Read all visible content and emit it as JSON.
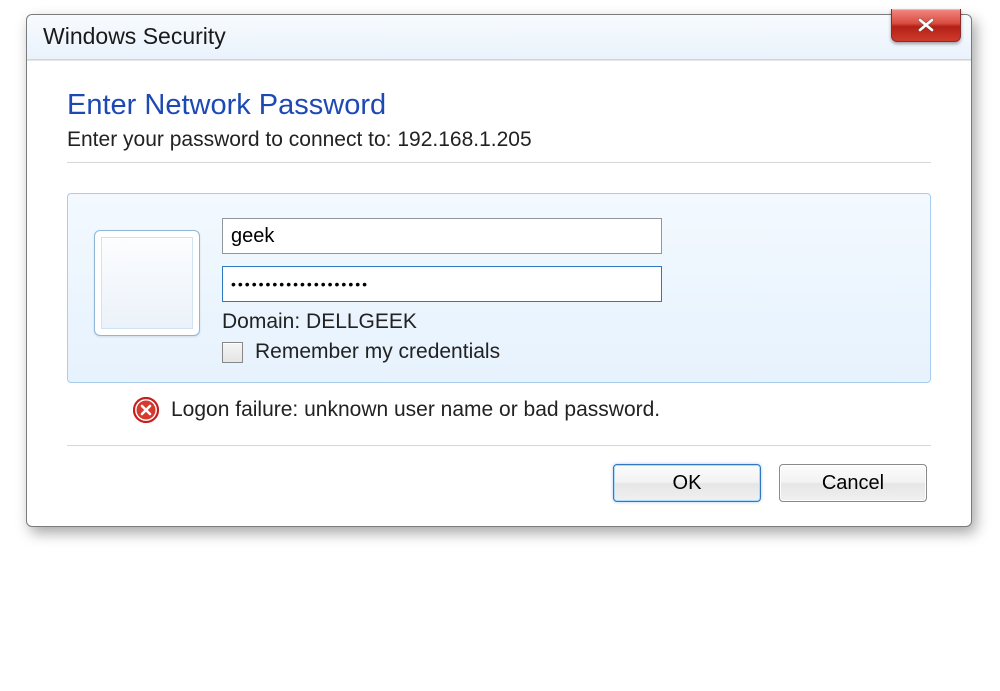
{
  "window": {
    "title": "Windows Security",
    "close_icon": "close-icon"
  },
  "dialog": {
    "heading": "Enter Network Password",
    "subheading": "Enter your password to connect to: 192.168.1.205"
  },
  "credentials": {
    "username_value": "geek",
    "password_value": "••••••••••••••••••••",
    "domain_label": "Domain: DELLGEEK",
    "remember_label": "Remember my credentials",
    "remember_checked": false
  },
  "error": {
    "message": "Logon failure: unknown user name or bad password."
  },
  "buttons": {
    "ok": "OK",
    "cancel": "Cancel"
  }
}
